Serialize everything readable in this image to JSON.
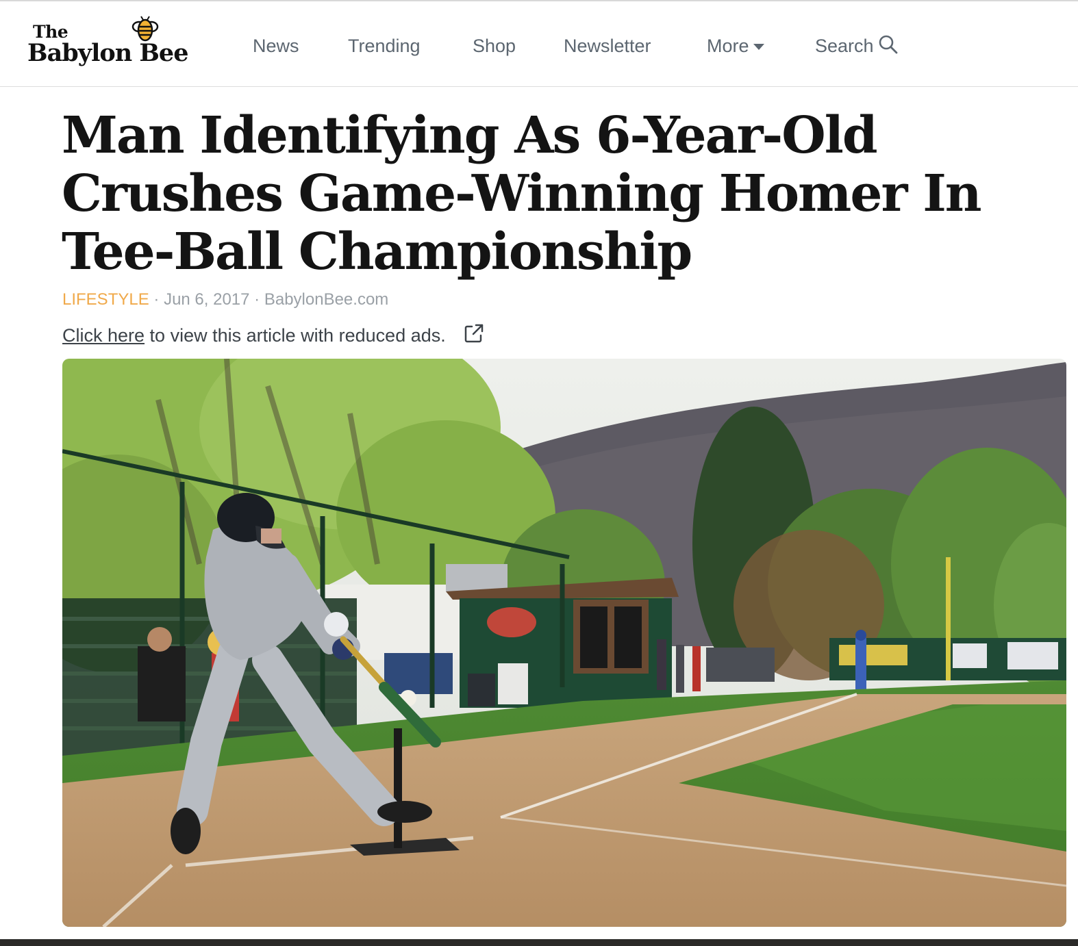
{
  "header": {
    "logo": {
      "line1": "The",
      "line2": "Babylon Bee"
    },
    "nav": [
      {
        "label": "News"
      },
      {
        "label": "Trending"
      },
      {
        "label": "Shop"
      },
      {
        "label": "Newsletter"
      },
      {
        "label": "More"
      },
      {
        "label": "Search"
      }
    ]
  },
  "article": {
    "headline": "Man Identifying As 6-Year-Old Crushes Game-Winning Homer In Tee-Ball Championship",
    "category": "LIFESTYLE",
    "separator": "·",
    "date": "Jun 6, 2017",
    "source": "BabylonBee.com",
    "reduced_ads": {
      "link_text": "Click here",
      "rest_text": " to view this article with reduced ads."
    }
  },
  "colors": {
    "accent": "#f0a94a",
    "nav_text": "#5c6670",
    "headline": "#141414"
  },
  "icons": {
    "logo": "bee-icon",
    "more": "caret-down-icon",
    "search": "magnifier-icon",
    "reduced_ads": "external-link-icon"
  }
}
